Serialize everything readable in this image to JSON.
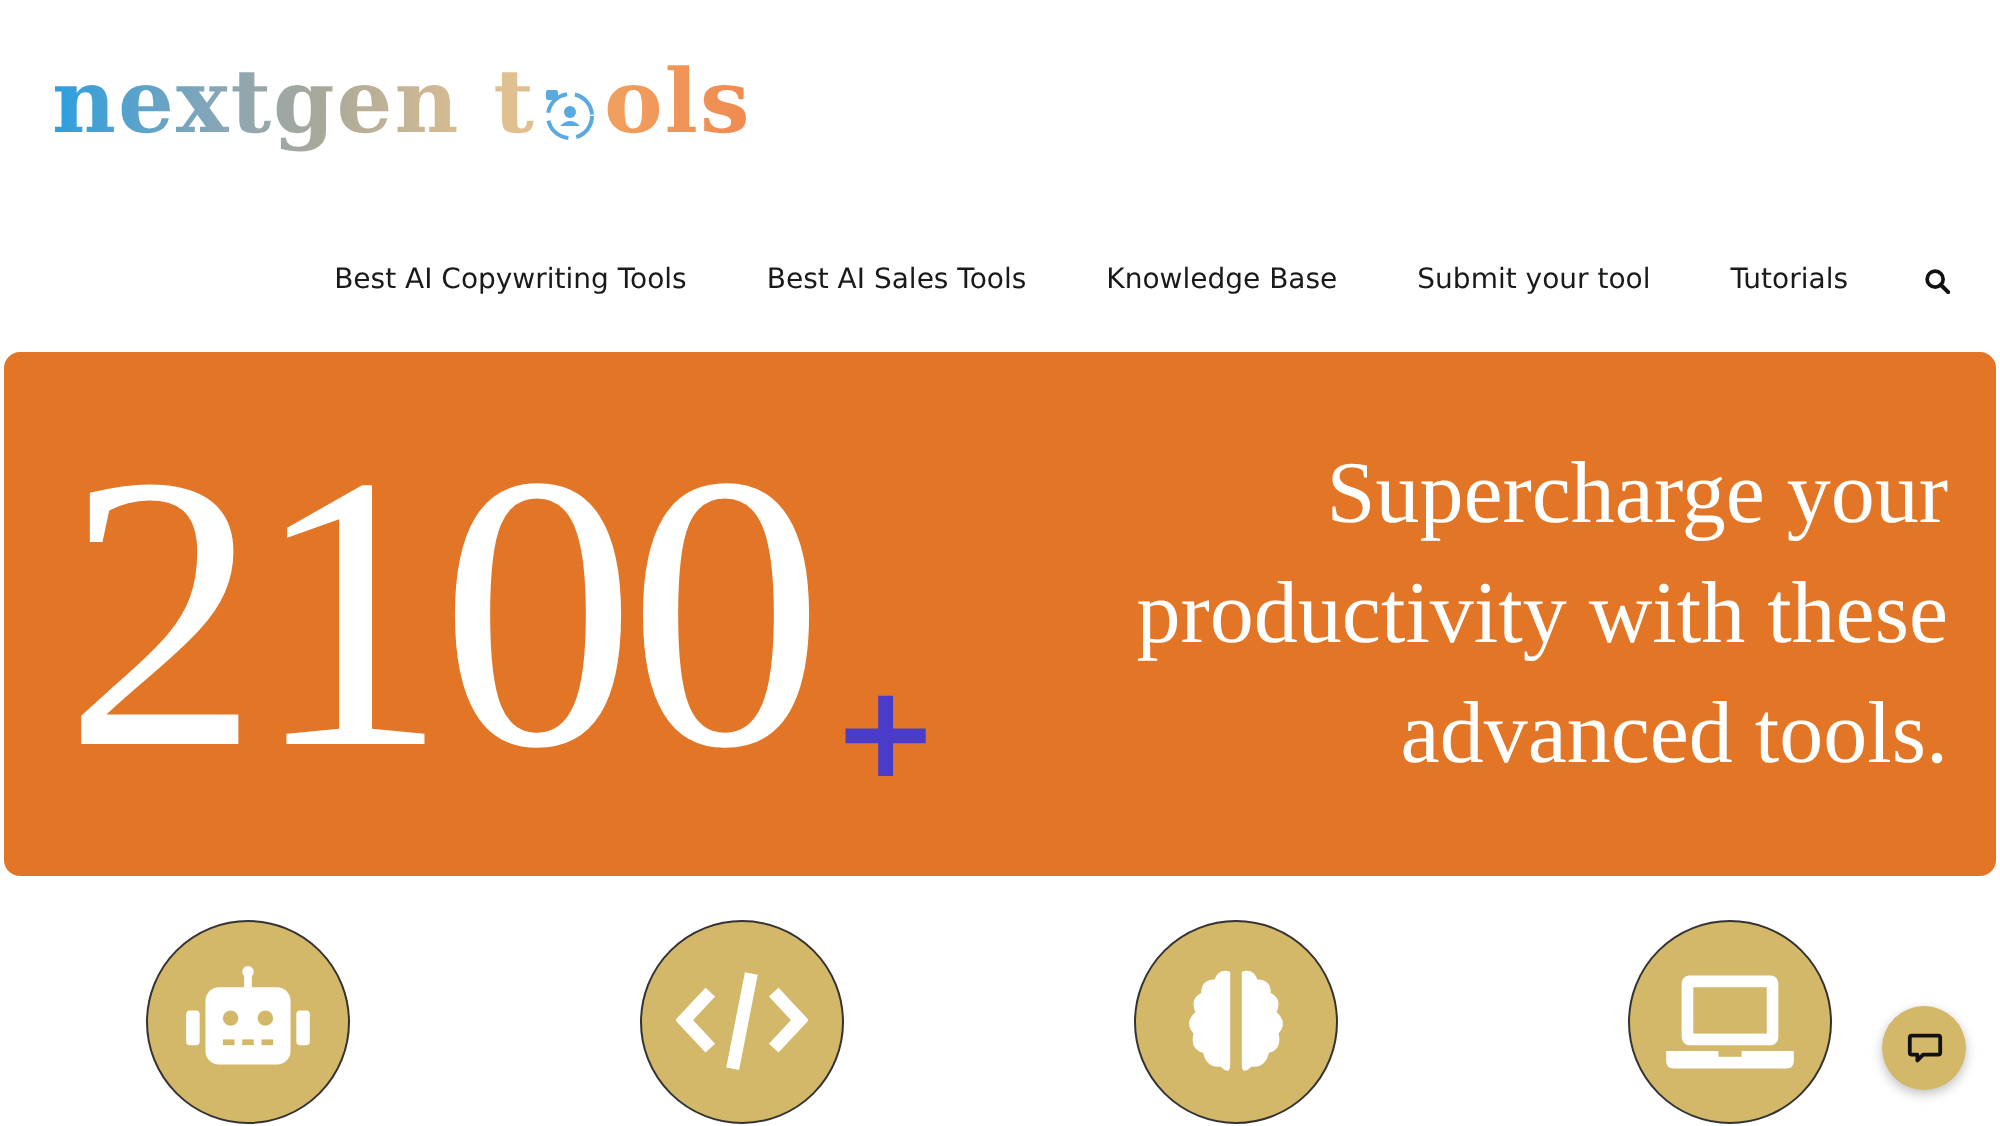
{
  "logo": {
    "before": "nextgen t",
    "after": "ols"
  },
  "nav": {
    "items": [
      "Best AI Copywriting Tools",
      "Best AI Sales Tools",
      "Knowledge Base",
      "Submit your tool",
      "Tutorials"
    ]
  },
  "hero": {
    "number": "2100",
    "plus": "+",
    "headline": "Supercharge your productivity with these advanced tools."
  }
}
